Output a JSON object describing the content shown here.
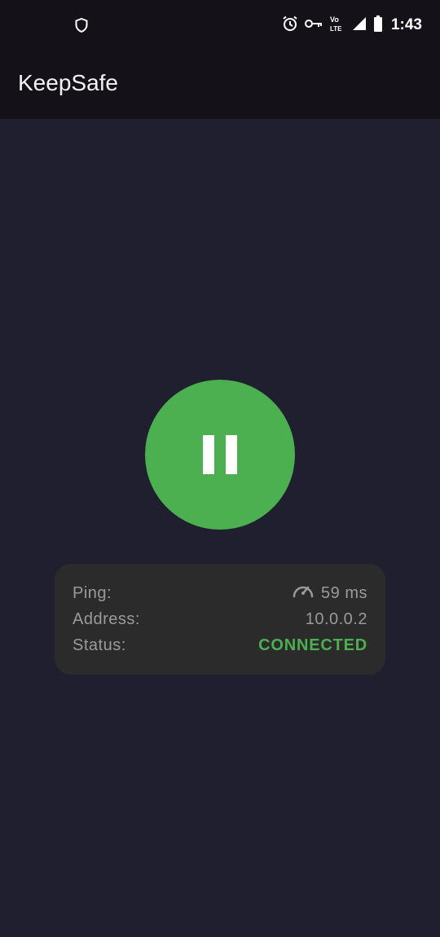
{
  "status_bar": {
    "time": "1:43",
    "network_label_top": "Vo",
    "network_label_bottom": "LTE",
    "icons": [
      "shield-icon",
      "alarm-icon",
      "vpn-key-icon",
      "volte-icon",
      "signal-icon",
      "battery-icon"
    ]
  },
  "app_bar": {
    "title": "KeepSafe"
  },
  "toggle": {
    "state_icon": "pause-icon",
    "color": "#4caf50"
  },
  "info": {
    "ping_label": "Ping:",
    "ping_value": "59 ms",
    "ping_icon": "speedometer-icon",
    "address_label": "Address:",
    "address_value": "10.0.0.2",
    "status_label": "Status:",
    "status_value": "CONNECTED",
    "status_color": "#4caf50"
  }
}
